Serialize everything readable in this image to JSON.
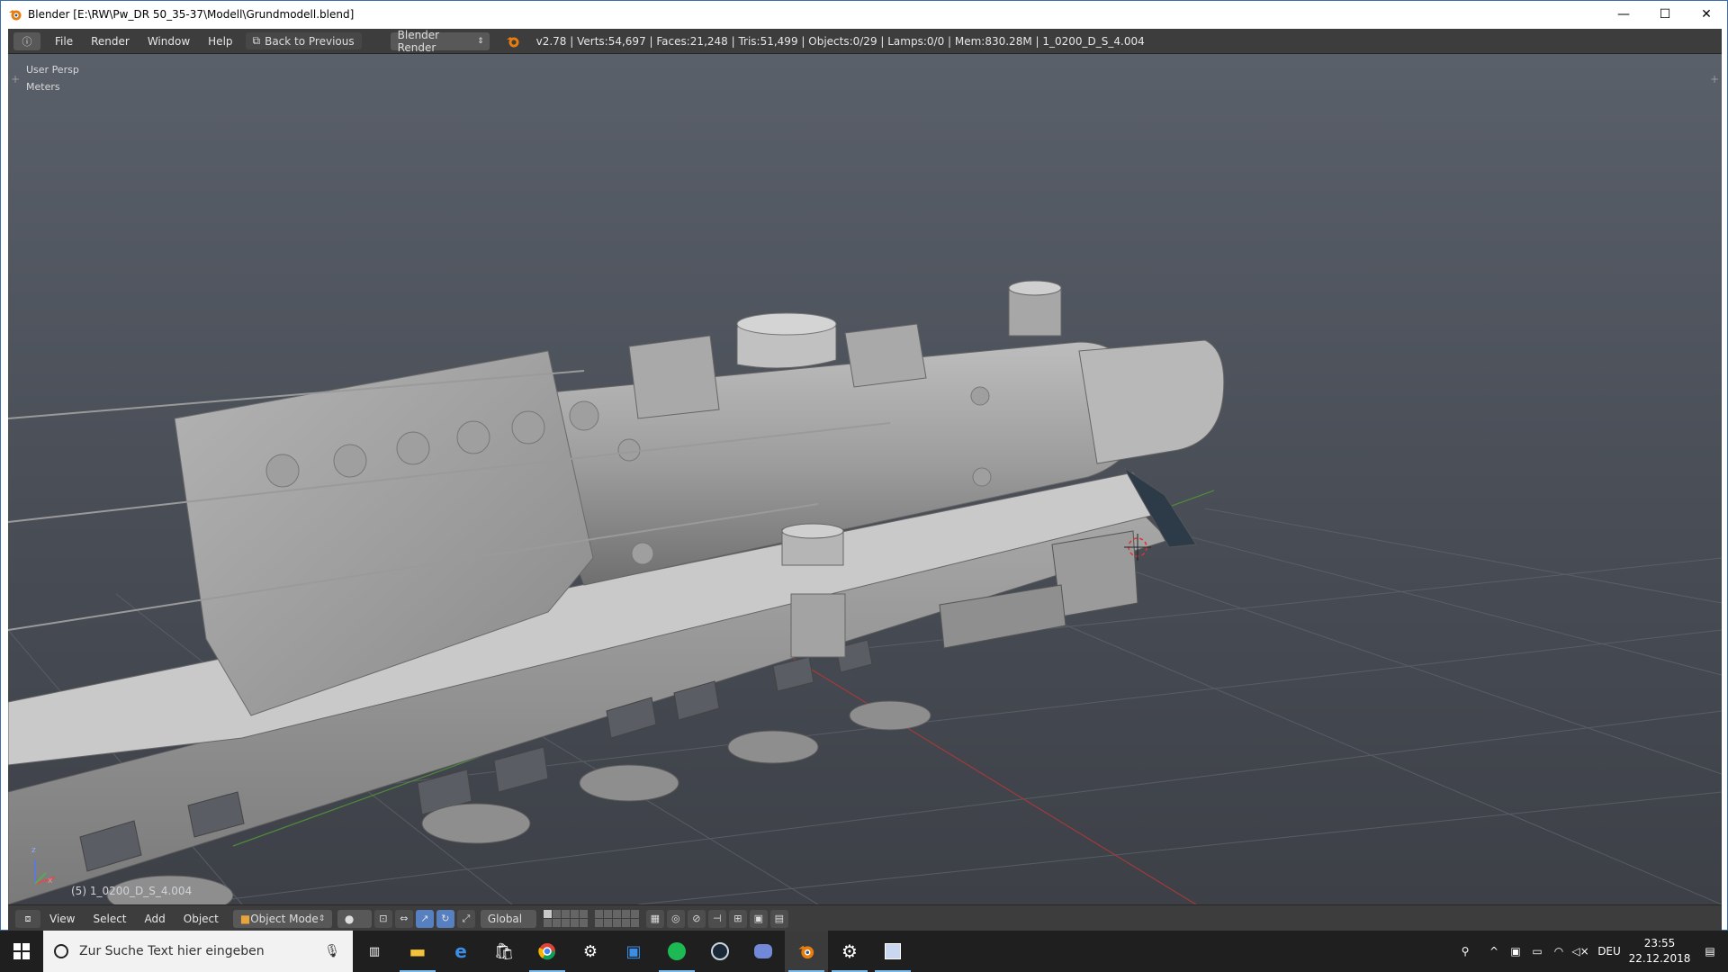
{
  "window": {
    "title": "Blender [E:\\RW\\Pw_DR 50_35-37\\Modell\\Grundmodell.blend]",
    "minimize_glyph": "—",
    "maximize_glyph": "☐",
    "close_glyph": "✕"
  },
  "info_header": {
    "menu": [
      "File",
      "Render",
      "Window",
      "Help"
    ],
    "back_label": "Back to Previous",
    "render_engine": "Blender Render",
    "stats": "v2.78 | Verts:54,697 | Faces:21,248 | Tris:51,499 | Objects:0/29 | Lamps:0/0 | Mem:830.28M | 1_0200_D_S_4.004"
  },
  "viewport": {
    "view_name": "User Persp",
    "units": "Meters",
    "object_label": "(5) 1_0200_D_S_4.004",
    "axis_x": "x",
    "axis_z": "z"
  },
  "viewport_header": {
    "menu": [
      "View",
      "Select",
      "Add",
      "Object"
    ],
    "mode": "Object Mode",
    "orientation": "Global"
  },
  "taskbar": {
    "search_placeholder": "Zur Suche Text hier eingeben",
    "language": "DEU",
    "time": "23:55",
    "date": "22.12.2018"
  },
  "colors": {
    "blender_orange": "#e87d0d",
    "header_bg": "#3d3d3d",
    "viewport_top": "#5a606a",
    "viewport_bottom": "#3d4047",
    "grid_x_axis": "#a33a3a",
    "grid_y_axis": "#4f8a3a",
    "taskbar_bg": "#1f1f1f"
  }
}
